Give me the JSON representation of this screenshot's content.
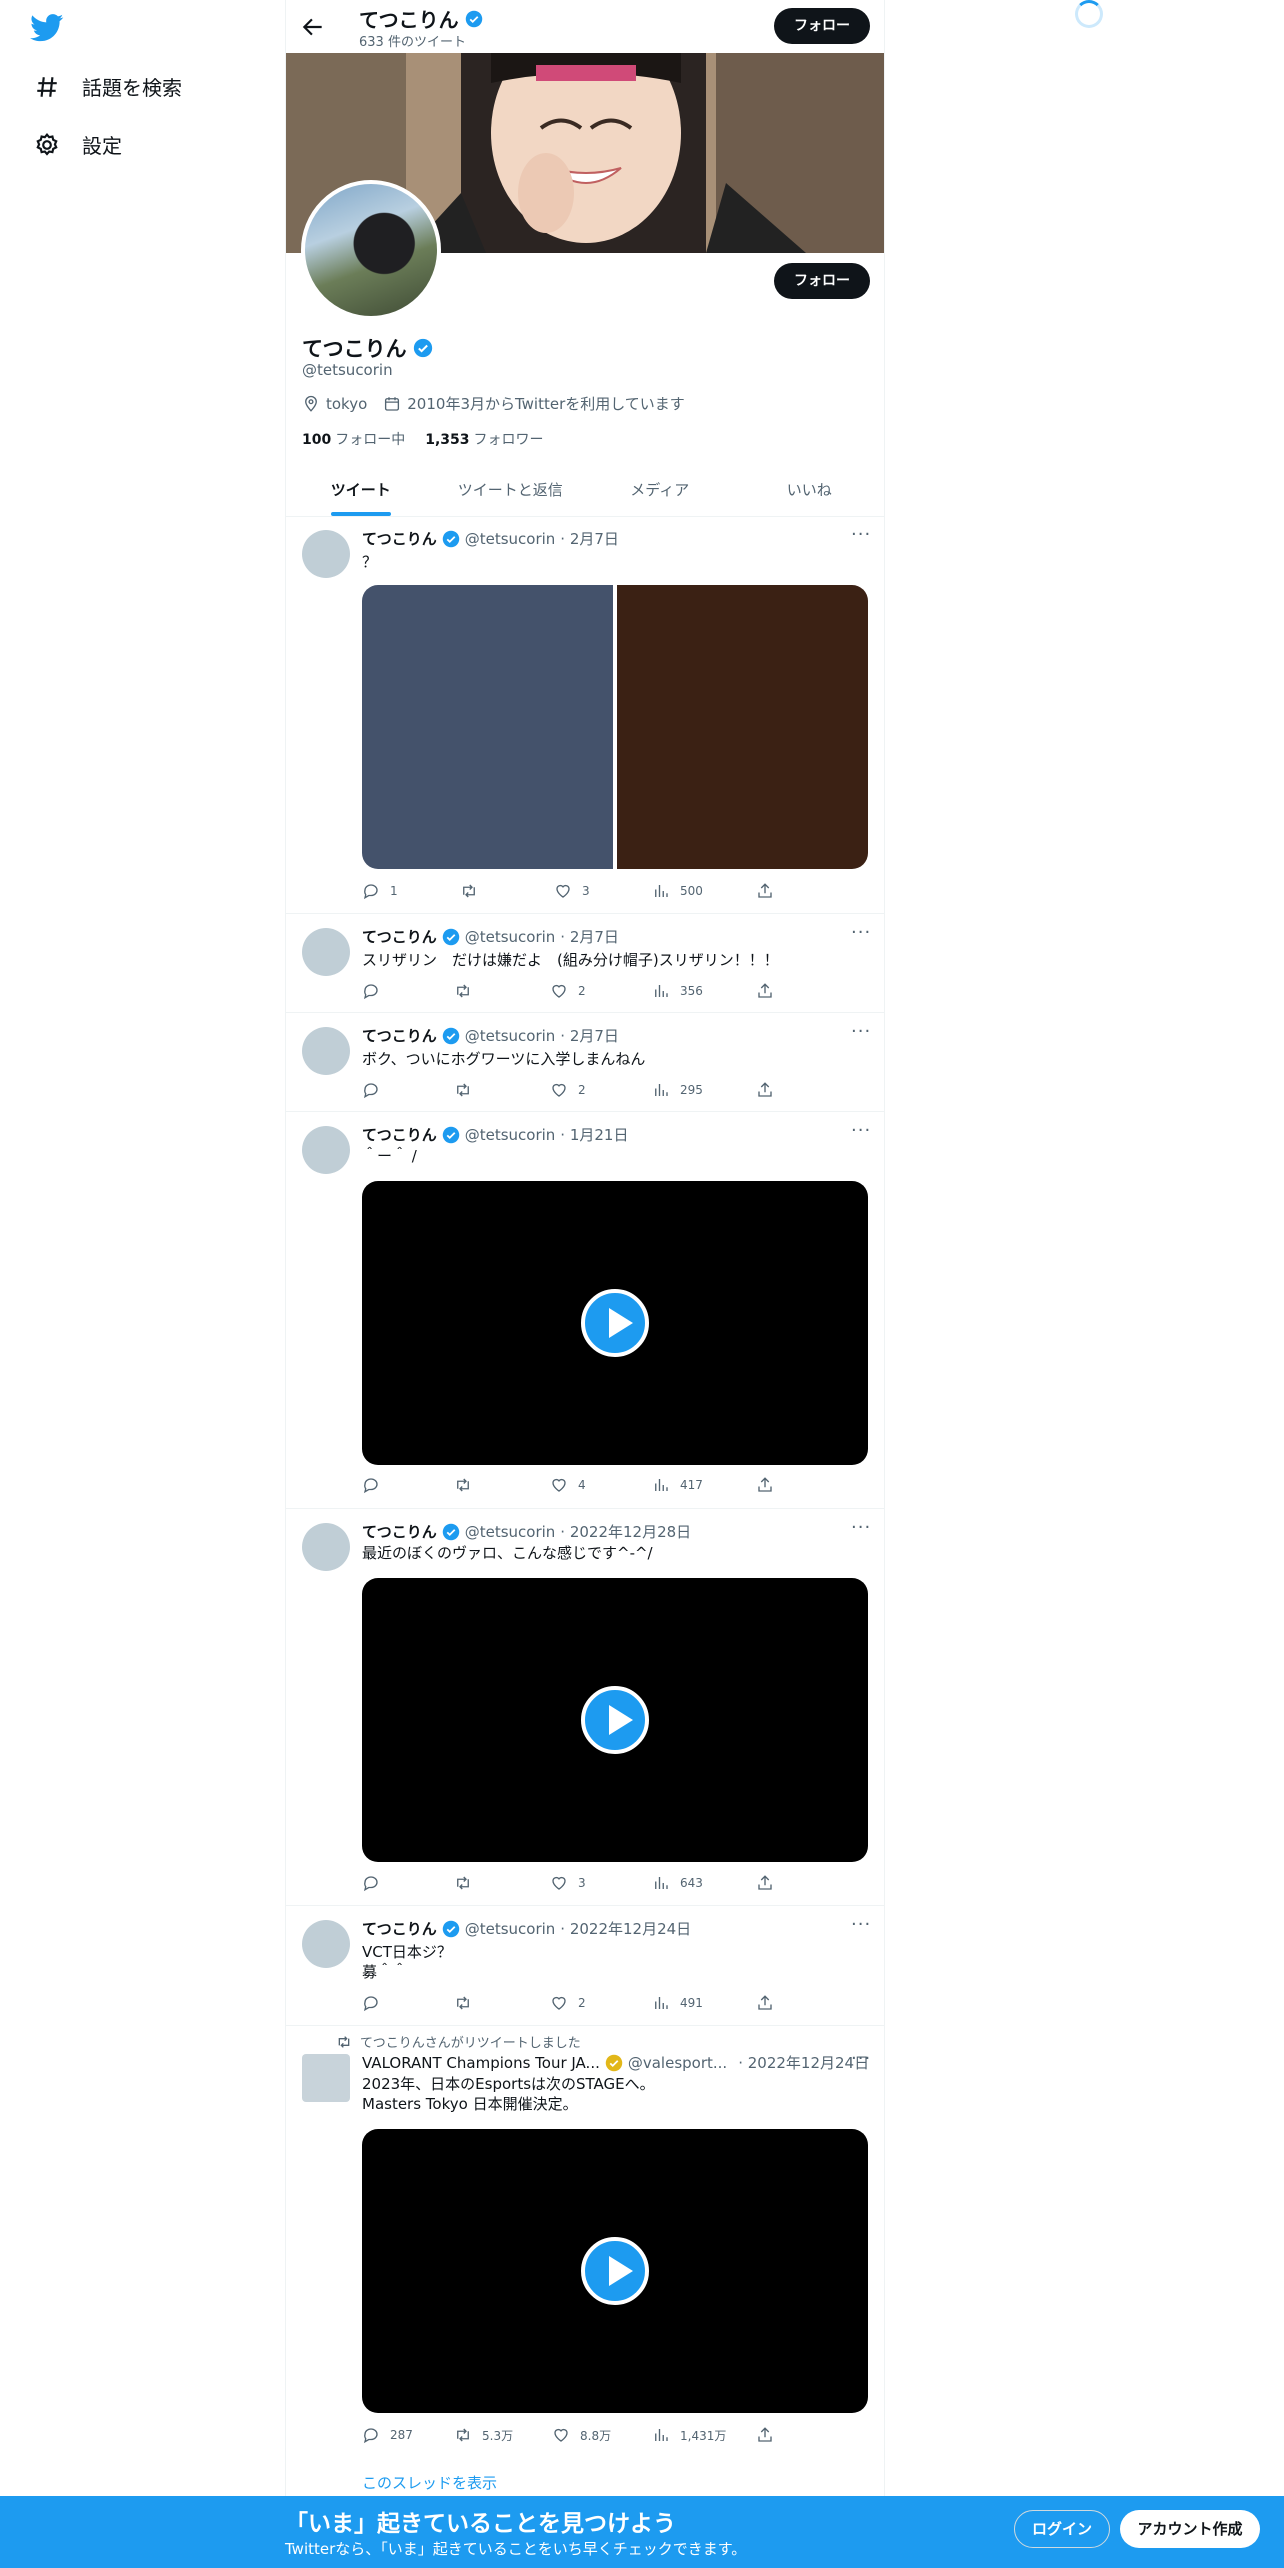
{
  "sidebar": {
    "items": [
      {
        "label": "話題を検索",
        "icon": "hashtag-icon"
      },
      {
        "label": "設定",
        "icon": "gear-icon"
      }
    ]
  },
  "header": {
    "name": "てつこりん",
    "tweet_count": "633 件のツイート",
    "follow_label": "フォロー"
  },
  "profile": {
    "name": "てつこりん",
    "handle": "@tetsucorin",
    "location": "tokyo",
    "joined": "2010年3月からTwitterを利用しています",
    "following_count": "100",
    "following_label": "フォロー中",
    "followers_count": "1,353",
    "followers_label": "フォロワー",
    "follow_label": "フォロー"
  },
  "tabs": [
    "ツイート",
    "ツイートと返信",
    "メディア",
    "いいね"
  ],
  "tweets": [
    {
      "name": "てつこりん",
      "handle": "@tetsucorin",
      "date": "· 2月7日",
      "text": "？",
      "media": "images",
      "reply": "1",
      "retweet": "",
      "like": "3",
      "views": "500"
    },
    {
      "name": "てつこりん",
      "handle": "@tetsucorin",
      "date": "· 2月7日",
      "text": "スリザリン　だけは嫌だよ　(組み分け帽子)スリザリン！！！",
      "media": "none",
      "reply": "",
      "retweet": "",
      "like": "2",
      "views": "356"
    },
    {
      "name": "てつこりん",
      "handle": "@tetsucorin",
      "date": "· 2月7日",
      "text": "ボク、ついにホグワーツに入学しまんねん",
      "media": "none",
      "reply": "",
      "retweet": "",
      "like": "2",
      "views": "295"
    },
    {
      "name": "てつこりん",
      "handle": "@tetsucorin",
      "date": "· 1月21日",
      "text": "＾ー＾ /",
      "media": "video",
      "reply": "",
      "retweet": "",
      "like": "4",
      "views": "417"
    },
    {
      "name": "てつこりん",
      "handle": "@tetsucorin",
      "date": "· 2022年12月28日",
      "text": "最近のぼくのヴァロ、こんな感じです^-^/",
      "media": "video",
      "reply": "",
      "retweet": "",
      "like": "3",
      "views": "643"
    },
    {
      "name": "てつこりん",
      "handle": "@tetsucorin",
      "date": "· 2022年12月24日",
      "text": "VCT日本ジ？\n募＾＾",
      "media": "none",
      "reply": "",
      "retweet": "",
      "like": "2",
      "views": "491"
    },
    {
      "retweeted_by": "てつこりんさんがリツイートしました",
      "name": "VALORANT Champions Tour JA...",
      "handle": "@valesport...",
      "date": "· 2022年12月24日",
      "text": "2023年、日本のEsportsは次のSTAGEへ。\nMasters Tokyo 日本開催決定。",
      "media": "video",
      "reply": "287",
      "retweet": "5.3万",
      "like": "8.8万",
      "views": "1,431万",
      "show_thread": "このスレッドを表示"
    }
  ],
  "bottom_bar": {
    "title": "「いま」起きていることを見つけよう",
    "subtitle": "Twitterなら、「いま」起きていることをいち早くチェックできます。",
    "login": "ログイン",
    "signup": "アカウント作成"
  },
  "colors": {
    "accent": "#1d9bf0",
    "text": "#0f1419",
    "secondary": "#536471"
  }
}
